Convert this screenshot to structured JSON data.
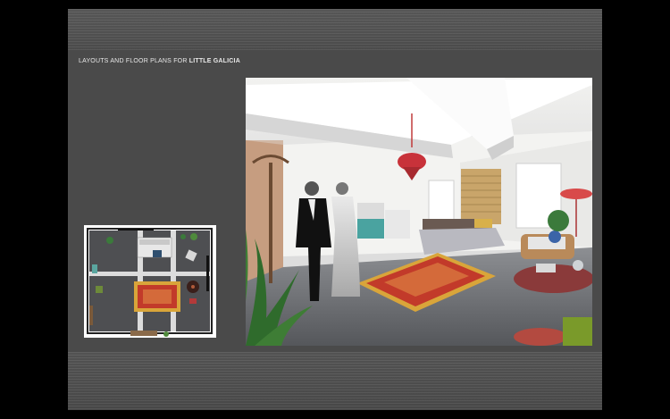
{
  "slide": {
    "title_prefix": "LAYOUTS AND FLOOR PLANS FOR ",
    "title_bold": "LITTLE GALICIA"
  },
  "colors": {
    "background": "#000000",
    "slide": "#4a4a4a",
    "band": "#555555",
    "rug_red": "#c23a2a",
    "rug_gold": "#d9a53a"
  },
  "images": {
    "floor_plan": "floor-plan-illustration",
    "room_render": "bedroom-interior-render"
  }
}
